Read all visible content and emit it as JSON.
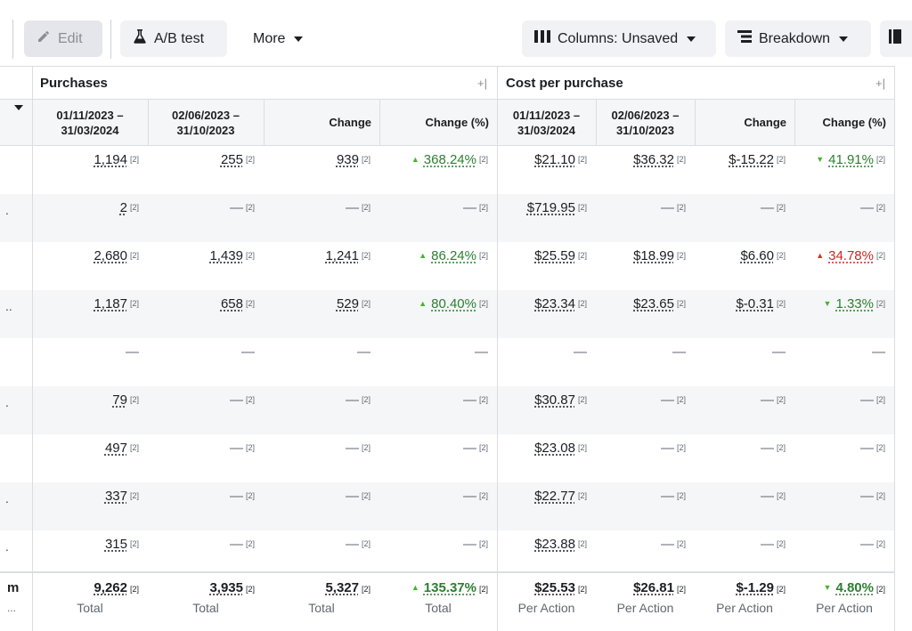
{
  "toolbar": {
    "edit_label": "Edit",
    "ab_label": "A/B test",
    "more_label": "More",
    "columns_label": "Columns: Unsaved",
    "breakdown_label": "Breakdown"
  },
  "groups": {
    "purchases": "Purchases",
    "cost": "Cost per purchase"
  },
  "headers": {
    "p_range1": "01/11/2023 –\n31/03/2024",
    "p_range2": "02/06/2023 –\n31/10/2023",
    "p_change": "Change",
    "p_change_pct": "Change (%)",
    "c_range1": "01/11/2023 –\n31/03/2024",
    "c_range2": "02/06/2023 –\n31/10/2023",
    "c_change": "Change",
    "c_change_pct": "Change (%)"
  },
  "note": "[2]",
  "dash": "—",
  "row_labels": [
    "",
    ".",
    "",
    "..",
    "",
    ".",
    "",
    ".",
    "."
  ],
  "rows": [
    {
      "p1": "1,194",
      "p2": "255",
      "pc": "939",
      "pp": "368.24%",
      "pdir": "up",
      "c1": "$21.10",
      "c2": "$36.32",
      "cc": "$-15.22",
      "cp": "41.91%",
      "cdir": "down"
    },
    {
      "p1": "2",
      "p2": "—",
      "pc": "—",
      "pp": "—",
      "pdir": "",
      "c1": "$719.95",
      "c2": "—",
      "cc": "—",
      "cp": "—",
      "cdir": ""
    },
    {
      "p1": "2,680",
      "p2": "1,439",
      "pc": "1,241",
      "pp": "86.24%",
      "pdir": "up",
      "c1": "$25.59",
      "c2": "$18.99",
      "cc": "$6.60",
      "cp": "34.78%",
      "cdir": "upbad"
    },
    {
      "p1": "1,187",
      "p2": "658",
      "pc": "529",
      "pp": "80.40%",
      "pdir": "up",
      "c1": "$23.34",
      "c2": "$23.65",
      "cc": "$-0.31",
      "cp": "1.33%",
      "cdir": "down"
    },
    {
      "p1": "—",
      "p2": "—",
      "pc": "—",
      "pp": "—",
      "pdir": "",
      "c1": "—",
      "c2": "—",
      "cc": "—",
      "cp": "—",
      "cdir": "",
      "blank": true
    },
    {
      "p1": "79",
      "p2": "—",
      "pc": "—",
      "pp": "—",
      "pdir": "",
      "c1": "$30.87",
      "c2": "—",
      "cc": "—",
      "cp": "—",
      "cdir": ""
    },
    {
      "p1": "497",
      "p2": "—",
      "pc": "—",
      "pp": "—",
      "pdir": "",
      "c1": "$23.08",
      "c2": "—",
      "cc": "—",
      "cp": "—",
      "cdir": ""
    },
    {
      "p1": "337",
      "p2": "—",
      "pc": "—",
      "pp": "—",
      "pdir": "",
      "c1": "$22.77",
      "c2": "—",
      "cc": "—",
      "cp": "—",
      "cdir": ""
    },
    {
      "p1": "315",
      "p2": "—",
      "pc": "—",
      "pp": "—",
      "pdir": "",
      "c1": "$23.88",
      "c2": "—",
      "cc": "—",
      "cp": "—",
      "cdir": ""
    }
  ],
  "totals": {
    "label1": "m",
    "label2": "...",
    "p1": "9,262",
    "p2": "3,935",
    "pc": "5,327",
    "pp": "135.37%",
    "c1": "$25.53",
    "c2": "$26.81",
    "cc": "$-1.29",
    "cp": "4.80%",
    "p_sub": "Total",
    "c_sub": "Per Action"
  }
}
